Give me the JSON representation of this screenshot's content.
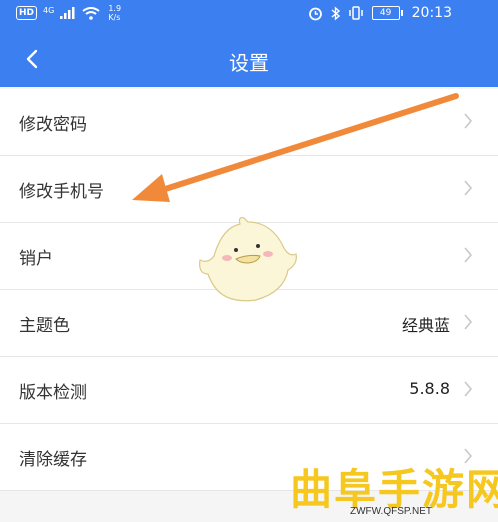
{
  "status_bar": {
    "hd": "HD",
    "network": "4G",
    "speed_value": "1.9",
    "speed_unit": "K/s",
    "battery": "49",
    "time": "20:13"
  },
  "nav": {
    "title": "设置",
    "back_icon": "chevron-left-icon"
  },
  "settings": [
    {
      "label": "修改密码",
      "value": ""
    },
    {
      "label": "修改手机号",
      "value": ""
    },
    {
      "label": "销户",
      "value": ""
    },
    {
      "label": "主题色",
      "value": "经典蓝"
    },
    {
      "label": "版本检测",
      "value": "5.8.8"
    },
    {
      "label": "清除缓存",
      "value": ""
    }
  ],
  "watermark": {
    "title": "曲阜手游网",
    "url": "ZWFW.QFSP.NET"
  },
  "colors": {
    "primary": "#3b7ff0",
    "arrow": "#f08a3a",
    "watermark": "#f6c71e"
  }
}
